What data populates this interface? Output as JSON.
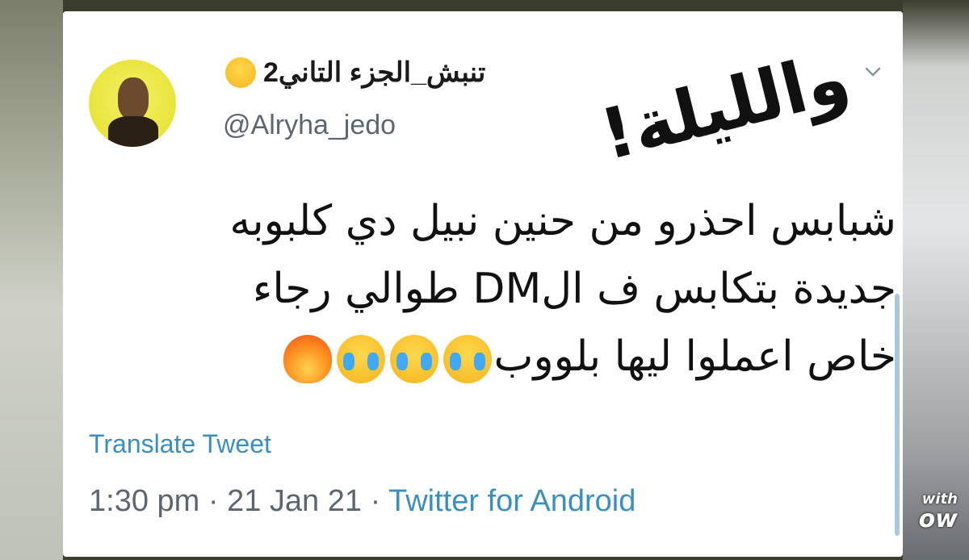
{
  "tweet": {
    "display_name": "تنبش_الجزء التاني2",
    "handle": "@Alryha_jedo",
    "sticker_text": "والليلة!",
    "text_lines": [
      "شبابس احذرو من حنين نبيل دي كلبوبه",
      "جديدة بتكابس ف الDM طوالي رجاء",
      "خاص اعملوا ليها بلووب"
    ],
    "translate_label": "Translate Tweet",
    "time": "1:30 pm",
    "separator": " · ",
    "date": "21 Jan 21",
    "source": "Twitter for Android"
  },
  "watermark": {
    "line1": "with",
    "line2": "ow"
  },
  "icons": {
    "name_emoji": "star-struck-emoji-icon",
    "menu": "chevron-down-icon",
    "line3_emojis": [
      "crying-face-emoji-icon",
      "crying-face-emoji-icon",
      "crying-face-emoji-icon",
      "fire-emoji-icon"
    ]
  },
  "colors": {
    "link": "#3b8fbf",
    "secondary_text": "#5c6670",
    "avatar_bg": "#e9e43a"
  }
}
